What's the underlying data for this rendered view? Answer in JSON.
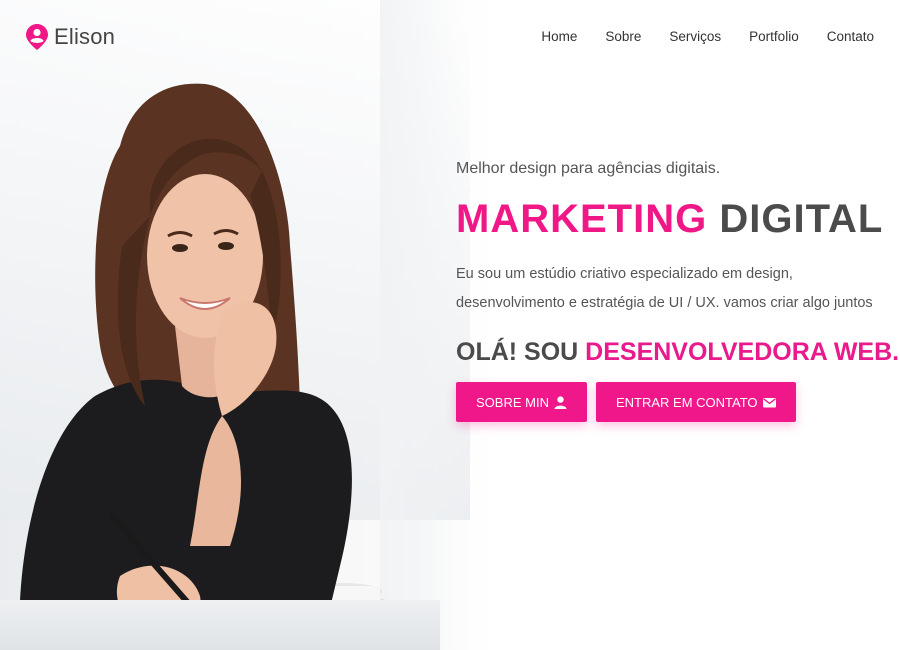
{
  "brand": {
    "name": "Elison",
    "logo_icon": "user-pin-icon"
  },
  "nav": {
    "items": [
      {
        "label": "Home"
      },
      {
        "label": "Sobre"
      },
      {
        "label": "Serviços"
      },
      {
        "label": "Portfolio"
      },
      {
        "label": "Contato"
      }
    ]
  },
  "hero": {
    "tagline": "Melhor design para agências digitais.",
    "headline_part1": "MARKETING",
    "headline_part2": "DIGITAL",
    "description": "Eu sou um estúdio criativo especializado em design, desenvolvimento e estratégia de UI / UX. vamos criar algo juntos",
    "subheadline_part1": "OLÁ! SOU",
    "subheadline_part2": "DESENVOLVEDORA WEB.",
    "buttons": {
      "about": {
        "label": "SOBRE MIN",
        "icon": "user-icon"
      },
      "contact": {
        "label": "ENTRAR EM CONTATO",
        "icon": "envelope-icon"
      }
    }
  },
  "colors": {
    "accent": "#f01887",
    "text_dark": "#4b4b4b",
    "text_body": "#555555",
    "background": "#ffffff"
  }
}
